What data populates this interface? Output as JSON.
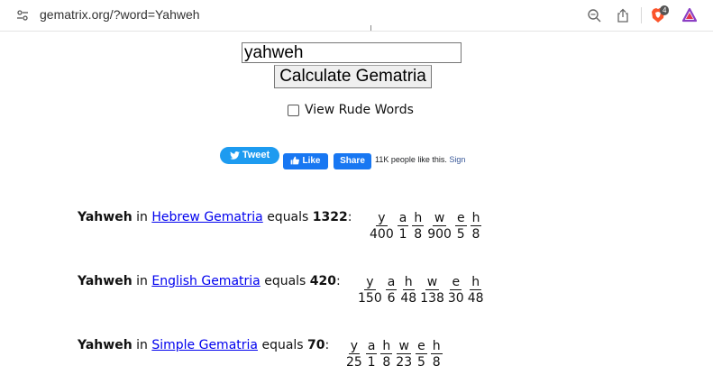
{
  "browser": {
    "url": "gematrix.org/?word=Yahweh",
    "shields_count": "4"
  },
  "form": {
    "input_value": "yahweh",
    "button_label": "Calculate Gematria",
    "checkbox_label": "View Rude Words"
  },
  "social": {
    "tweet_label": "Tweet",
    "like_label": "Like",
    "share_label": "Share",
    "fb_text": "11K people like this.",
    "fb_signup": "Sign"
  },
  "results": [
    {
      "word": "Yahweh",
      "in": "in",
      "system": "Hebrew Gematria",
      "equals": "equals",
      "value": "1322",
      "letters": [
        {
          "l": "y",
          "v": "400"
        },
        {
          "l": "a",
          "v": "1"
        },
        {
          "l": "h",
          "v": "8"
        },
        {
          "l": "w",
          "v": "900"
        },
        {
          "l": "e",
          "v": "5"
        },
        {
          "l": "h",
          "v": "8"
        }
      ]
    },
    {
      "word": "Yahweh",
      "in": "in",
      "system": "English Gematria",
      "equals": "equals",
      "value": "420",
      "letters": [
        {
          "l": "y",
          "v": "150"
        },
        {
          "l": "a",
          "v": "6"
        },
        {
          "l": "h",
          "v": "48"
        },
        {
          "l": "w",
          "v": "138"
        },
        {
          "l": "e",
          "v": "30"
        },
        {
          "l": "h",
          "v": "48"
        }
      ]
    },
    {
      "word": "Yahweh",
      "in": "in",
      "system": "Simple Gematria",
      "equals": "equals",
      "value": "70",
      "letters": [
        {
          "l": "y",
          "v": "25"
        },
        {
          "l": "a",
          "v": "1"
        },
        {
          "l": "h",
          "v": "8"
        },
        {
          "l": "w",
          "v": "23"
        },
        {
          "l": "e",
          "v": "5"
        },
        {
          "l": "h",
          "v": "8"
        }
      ]
    }
  ]
}
